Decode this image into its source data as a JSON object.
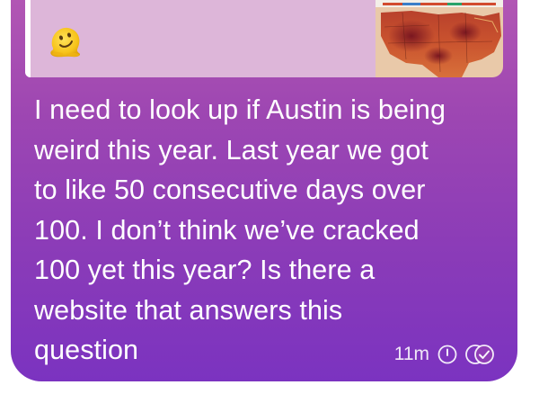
{
  "message": {
    "lines": [
      "I need to look up if Austin is being",
      "weird this year. Last year we got",
      "to like 50 consecutive days over",
      "100. I don’t think we’ve cracked",
      "100 yet this year? Is there a",
      "website that answers this",
      "question"
    ],
    "timestamp": "11m",
    "status_icons": [
      "disappearing-timer-icon",
      "read-double-check-icon"
    ]
  },
  "reply_preview": {
    "emoji_icon": "melting-face-emoji",
    "thumbnail_icon": "us-heat-map-thumbnail"
  },
  "colors": {
    "bubble_top": "#b85bb4",
    "bubble_bottom": "#7b33c0",
    "quote_background": "#ddb6d9",
    "text": "#ffffff"
  }
}
